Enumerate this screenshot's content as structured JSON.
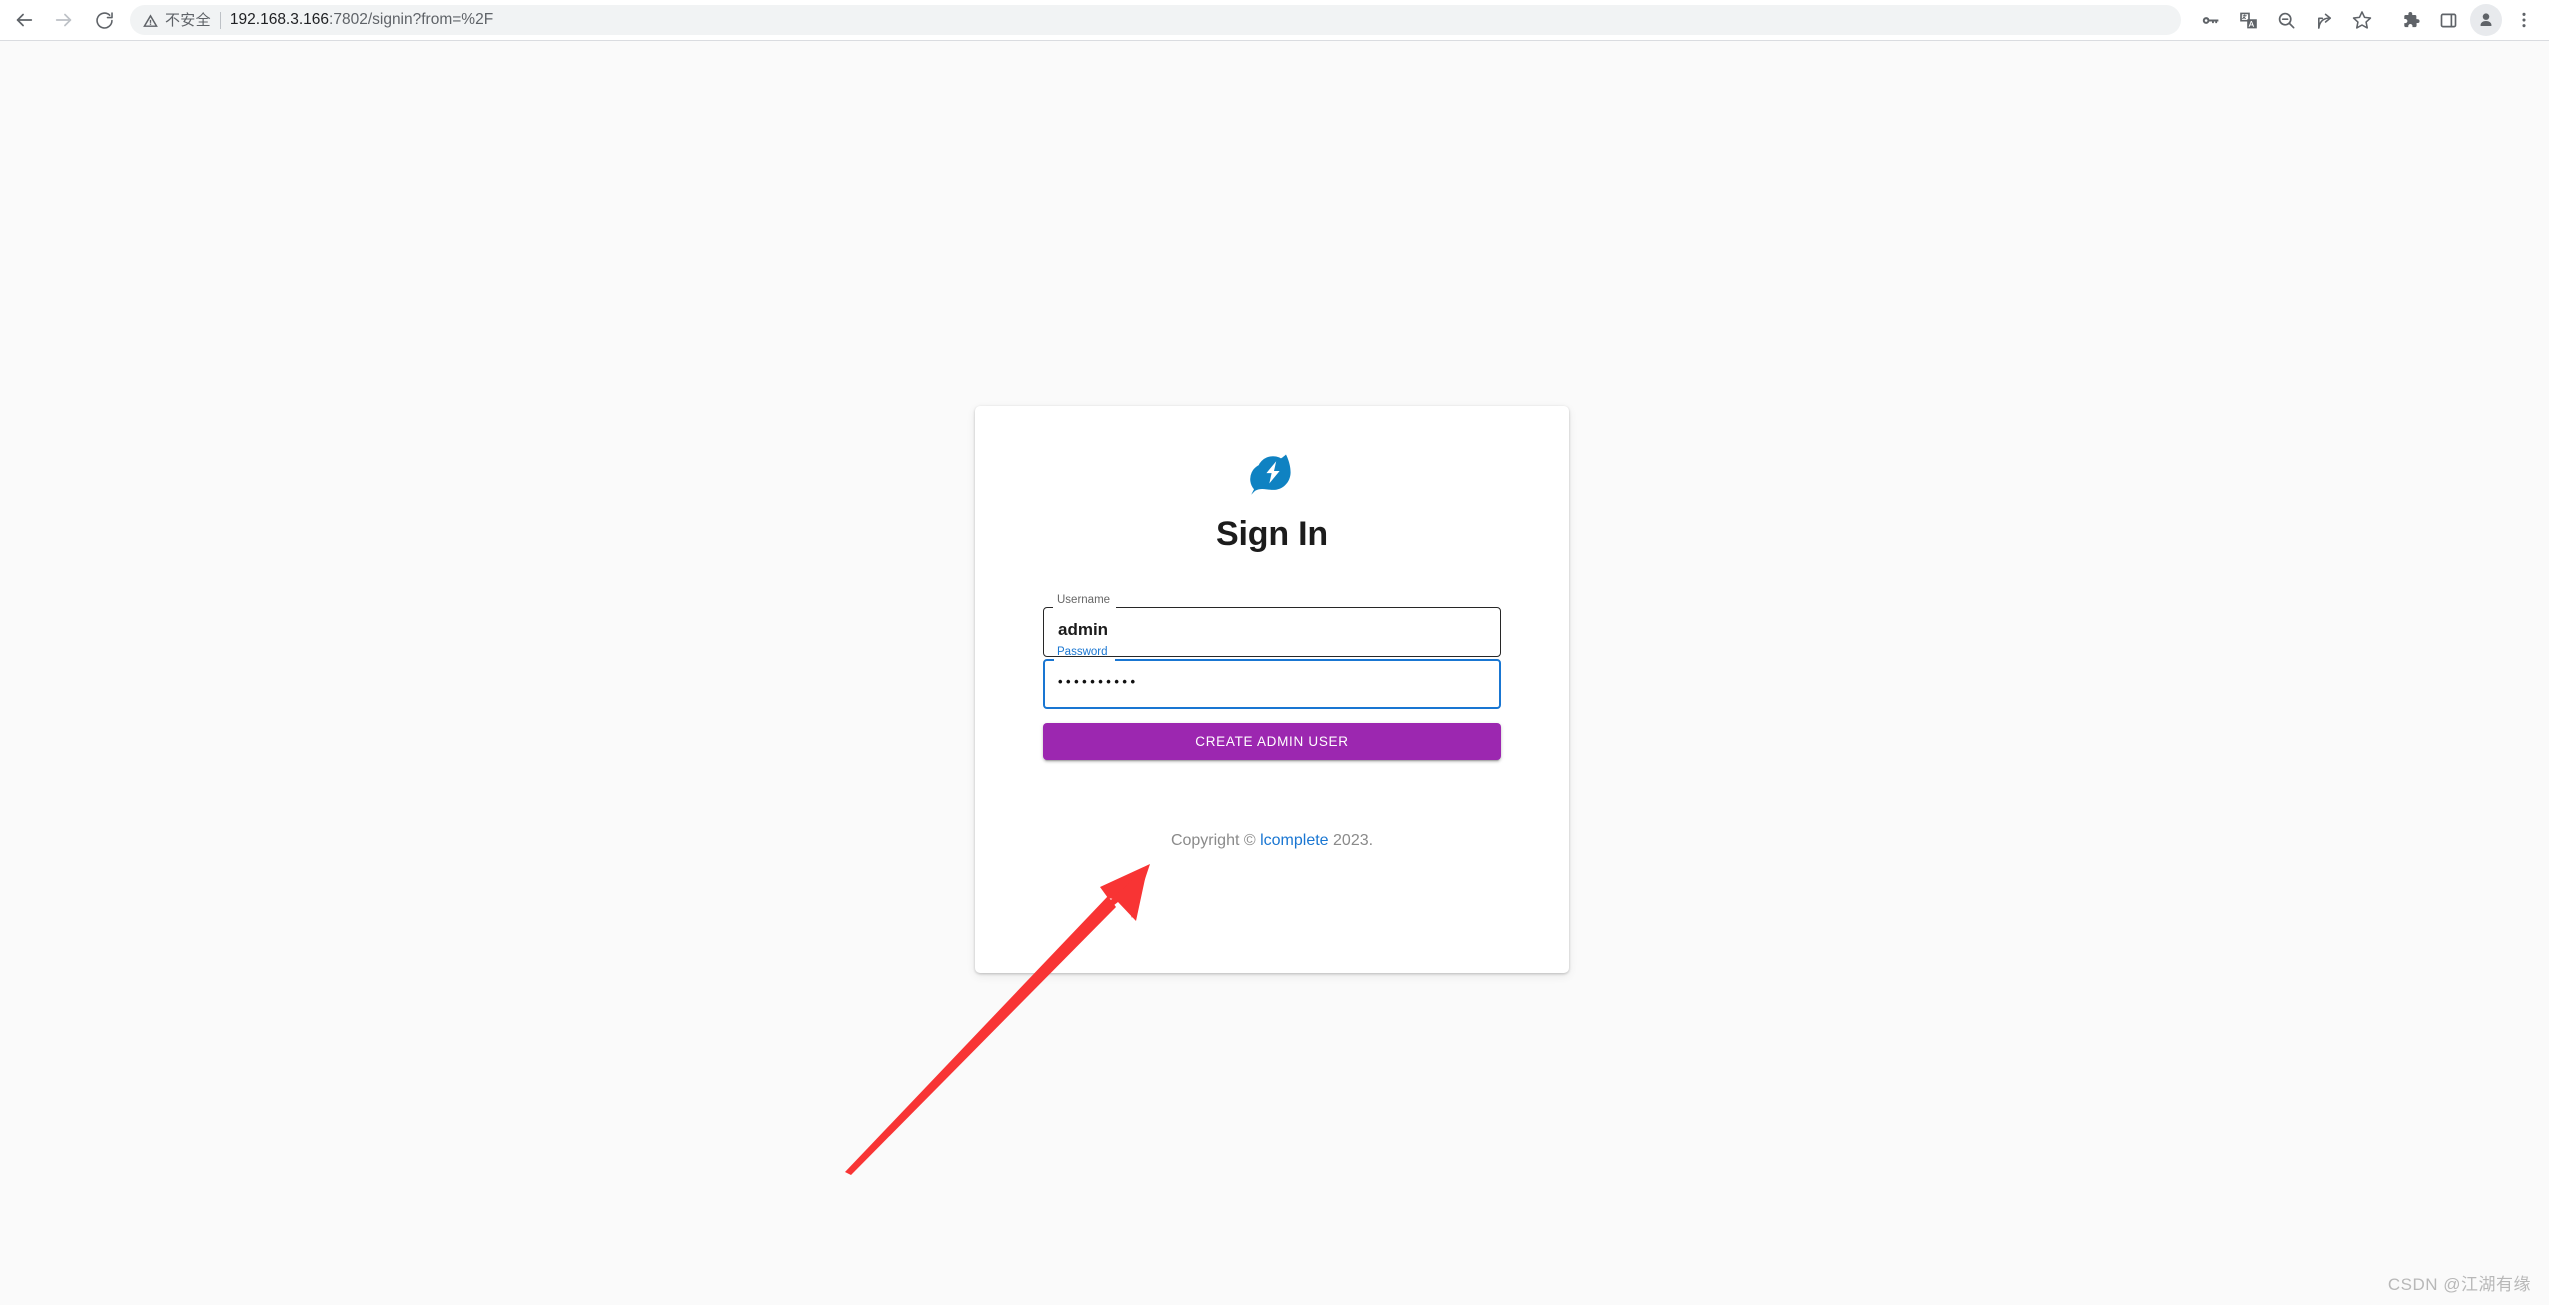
{
  "browser": {
    "nav": {
      "back_icon": "arrow-left-icon",
      "forward_icon": "arrow-right-icon",
      "reload_icon": "reload-icon"
    },
    "omnibox": {
      "security_icon": "warning-triangle-icon",
      "security_label": "不安全",
      "url_host": "192.168.3.166",
      "url_rest": ":7802/signin?from=%2F",
      "full_url": "192.168.3.166:7802/signin?from=%2F"
    },
    "toolbar_icons": [
      {
        "name": "password-key-icon",
        "label": "Passwords"
      },
      {
        "name": "translate-icon",
        "label": "Translate"
      },
      {
        "name": "zoom-out-icon",
        "label": "Zoom out"
      },
      {
        "name": "share-icon",
        "label": "Share"
      },
      {
        "name": "bookmark-star-icon",
        "label": "Bookmark"
      },
      {
        "name": "extensions-puzzle-icon",
        "label": "Extensions"
      },
      {
        "name": "side-panel-icon",
        "label": "Side panel"
      },
      {
        "name": "profile-avatar-icon",
        "label": "Profile"
      },
      {
        "name": "more-menu-icon",
        "label": "Customize and control"
      }
    ]
  },
  "login": {
    "logo": "leaf-lightning-logo-icon",
    "logo_color": "#0f82c2",
    "title": "Sign In",
    "fields": [
      {
        "name": "username",
        "label": "Username",
        "value": "admin",
        "placeholder": "Username",
        "focused": false
      },
      {
        "name": "password",
        "label": "Password",
        "value": "••••••••••",
        "placeholder": "Password",
        "focused": true
      }
    ],
    "submit_label": "CREATE ADMIN USER",
    "submit_color": "#9c27b0",
    "focus_color": "#1976d2",
    "footer": {
      "prefix": "Copyright © ",
      "link": "lcomplete",
      "suffix": " 2023."
    }
  },
  "annotation": {
    "arrow_color": "#f83434",
    "arrow_from": "bottom-left",
    "arrow_to": "create-admin-user-button"
  },
  "watermark": {
    "text": "CSDN @江湖有缘"
  }
}
